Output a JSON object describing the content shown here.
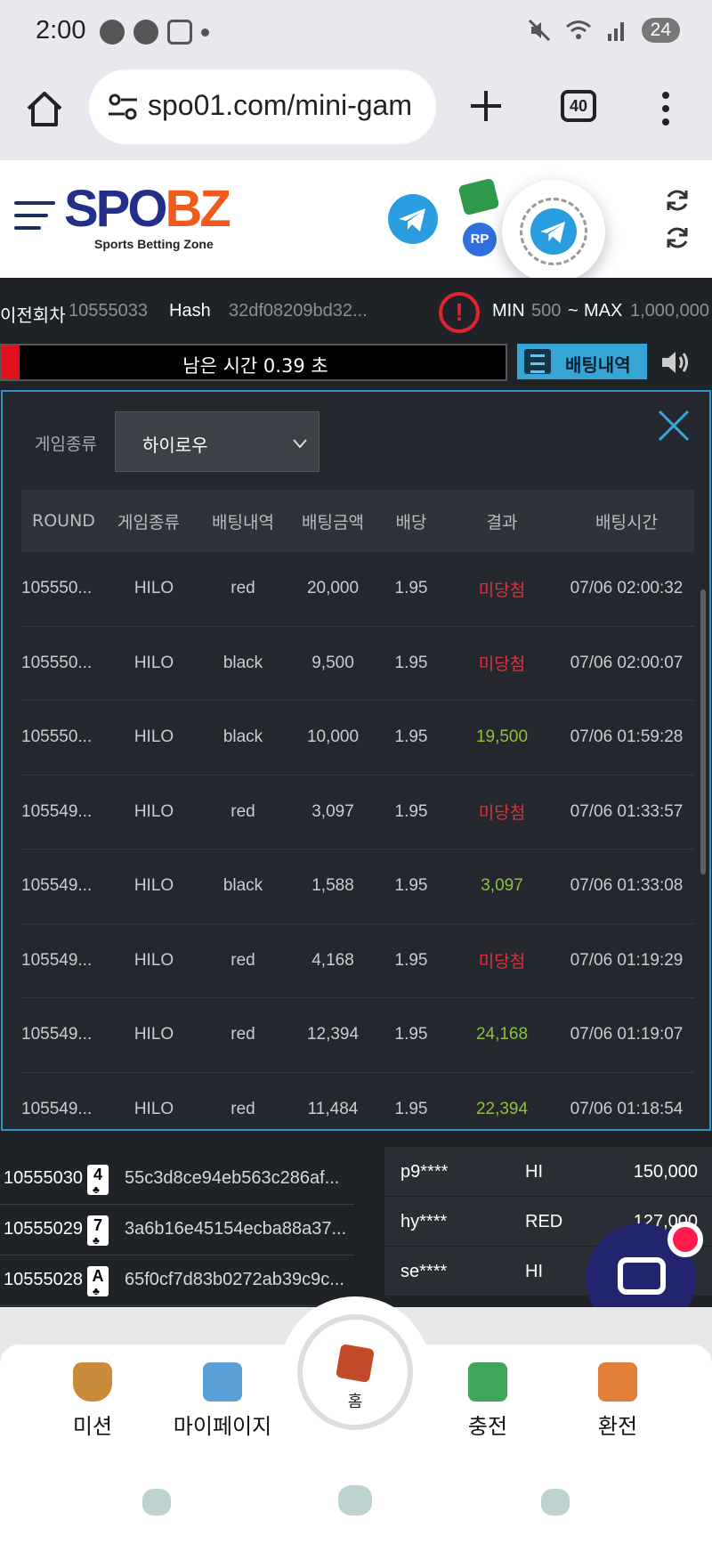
{
  "status_bar": {
    "time": "2:00",
    "battery": "24"
  },
  "browser": {
    "url": "spo01.com/mini-gam",
    "tab_count": "40"
  },
  "site": {
    "logo_part1": "SPO",
    "logo_part2": "BZ",
    "tagline": "Sports Betting Zone",
    "rp_label": "RP"
  },
  "info": {
    "prev_round_label": "이전회차",
    "prev_round_value": "10555033",
    "hash_label": "Hash",
    "hash_value": "32df08209bd32...",
    "min_label": "MIN",
    "min_value": "500",
    "tilde": "~",
    "max_label": "MAX",
    "max_value": "1,000,000",
    "warning_glyph": "!"
  },
  "timer": {
    "text": "남은 시간 0.39 초",
    "history_button": "배팅내역"
  },
  "modal": {
    "filter_label": "게임종류",
    "filter_value": "하이로우",
    "columns": [
      "ROUND",
      "게임종류",
      "배팅내역",
      "배팅금액",
      "배당",
      "결과",
      "배팅시간"
    ],
    "rows": [
      {
        "round": "105550...",
        "game": "HILO",
        "pick": "red",
        "amount": "20,000",
        "odds": "1.95",
        "result": "미당첨",
        "win": false,
        "time": "07/06 02:00:32"
      },
      {
        "round": "105550...",
        "game": "HILO",
        "pick": "black",
        "amount": "9,500",
        "odds": "1.95",
        "result": "미당첨",
        "win": false,
        "time": "07/06 02:00:07"
      },
      {
        "round": "105550...",
        "game": "HILO",
        "pick": "black",
        "amount": "10,000",
        "odds": "1.95",
        "result": "19,500",
        "win": true,
        "time": "07/06 01:59:28"
      },
      {
        "round": "105549...",
        "game": "HILO",
        "pick": "red",
        "amount": "3,097",
        "odds": "1.95",
        "result": "미당첨",
        "win": false,
        "time": "07/06 01:33:57"
      },
      {
        "round": "105549...",
        "game": "HILO",
        "pick": "black",
        "amount": "1,588",
        "odds": "1.95",
        "result": "3,097",
        "win": true,
        "time": "07/06 01:33:08"
      },
      {
        "round": "105549...",
        "game": "HILO",
        "pick": "red",
        "amount": "4,168",
        "odds": "1.95",
        "result": "미당첨",
        "win": false,
        "time": "07/06 01:19:29"
      },
      {
        "round": "105549...",
        "game": "HILO",
        "pick": "red",
        "amount": "12,394",
        "odds": "1.95",
        "result": "24,168",
        "win": true,
        "time": "07/06 01:19:07"
      },
      {
        "round": "105549...",
        "game": "HILO",
        "pick": "red",
        "amount": "11,484",
        "odds": "1.95",
        "result": "22,394",
        "win": true,
        "time": "07/06 01:18:54"
      }
    ]
  },
  "history": [
    {
      "round": "10555030",
      "card_rank": "4",
      "card_suit": "♣",
      "hash": "55c3d8ce94eb563c286af..."
    },
    {
      "round": "10555029",
      "card_rank": "7",
      "card_suit": "♣",
      "hash": "3a6b16e45154ecba88a37..."
    },
    {
      "round": "10555028",
      "card_rank": "A",
      "card_suit": "♣",
      "hash": "65f0cf7d83b0272ab39c9c..."
    }
  ],
  "live_bets": [
    {
      "user": "p9****",
      "pick": "HI",
      "amount": "150,000"
    },
    {
      "user": "hy****",
      "pick": "RED",
      "amount": "127,000"
    },
    {
      "user": "se****",
      "pick": "HI",
      "amount": ""
    }
  ],
  "bottom_nav": {
    "mission": "미션",
    "mypage": "마이페이지",
    "home": "홈",
    "deposit": "충전",
    "withdraw": "환전"
  },
  "colors": {
    "accent": "#36a5d6",
    "lose": "#d9343f",
    "win": "#8fc23a",
    "brand_blue": "#23308a",
    "brand_orange": "#f05a1a"
  }
}
